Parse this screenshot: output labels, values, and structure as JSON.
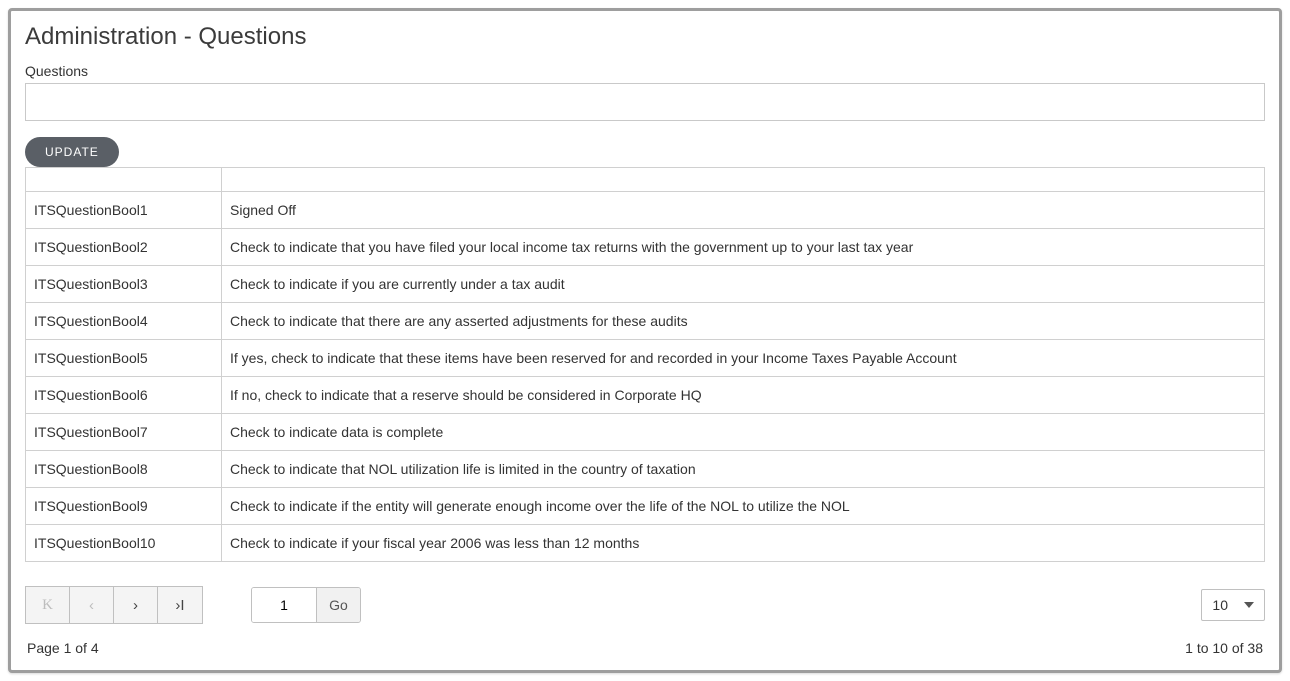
{
  "title": "Administration - Questions",
  "form": {
    "questions_label": "Questions",
    "questions_value": "",
    "update_label": "UPDATE"
  },
  "table": {
    "headers": [
      "",
      ""
    ],
    "rows": [
      {
        "id": "ITSQuestionBool1",
        "desc": "Signed Off"
      },
      {
        "id": "ITSQuestionBool2",
        "desc": "Check to indicate that you have filed your local income tax returns with the government up to your last tax year"
      },
      {
        "id": "ITSQuestionBool3",
        "desc": "Check to indicate if you are currently under a tax audit"
      },
      {
        "id": "ITSQuestionBool4",
        "desc": "Check to indicate that there are any asserted adjustments for these audits"
      },
      {
        "id": "ITSQuestionBool5",
        "desc": "If yes, check to indicate that these items have been reserved for and recorded in your Income Taxes Payable Account"
      },
      {
        "id": "ITSQuestionBool6",
        "desc": "If no, check to indicate that a reserve should be considered in Corporate HQ"
      },
      {
        "id": "ITSQuestionBool7",
        "desc": "Check to indicate data is complete"
      },
      {
        "id": "ITSQuestionBool8",
        "desc": "Check to indicate that NOL utilization life is limited in the country of taxation"
      },
      {
        "id": "ITSQuestionBool9",
        "desc": "Check to indicate if the entity will generate enough income over the life of the NOL to utilize the NOL"
      },
      {
        "id": "ITSQuestionBool10",
        "desc": "Check to indicate if your fiscal year 2006 was less than 12 months"
      }
    ]
  },
  "pager": {
    "first_glyph": "K",
    "prev_glyph": "‹",
    "next_glyph": "›",
    "last_glyph": "›I",
    "page_value": "1",
    "go_label": "Go",
    "page_size": "10",
    "page_status": "Page 1 of 4",
    "range_status": "1 to 10 of 38"
  }
}
